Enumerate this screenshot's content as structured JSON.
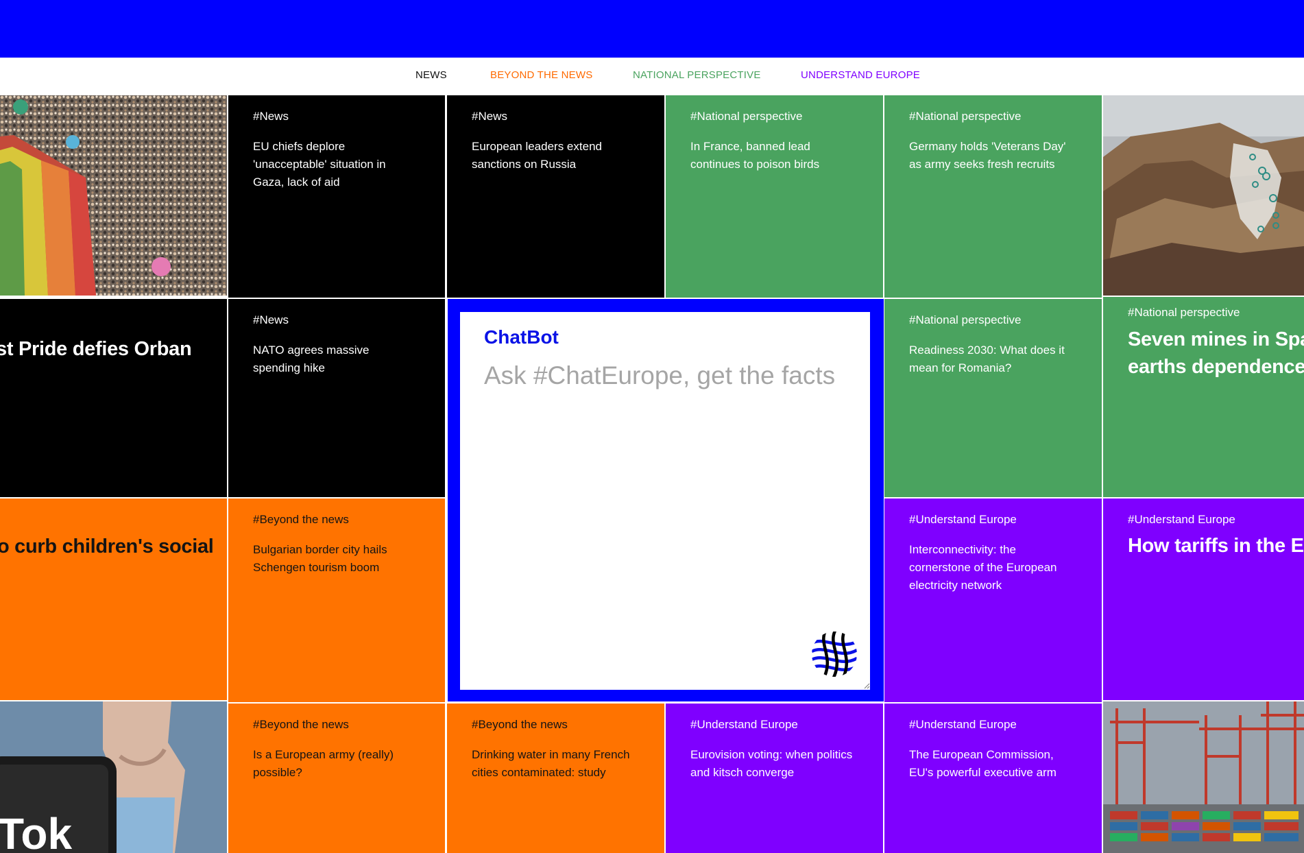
{
  "nav": {
    "items": [
      {
        "label": "NEWS",
        "color": "#111111"
      },
      {
        "label": "BEYOND THE NEWS",
        "color": "#ff6a00"
      },
      {
        "label": "NATIONAL PERSPECTIVE",
        "color": "#4aa35f"
      },
      {
        "label": "UNDERSTAND EUROPE",
        "color": "#7f00ff"
      }
    ]
  },
  "colors": {
    "brand_blue": "#0000ff",
    "news": "#000000",
    "national": "#4aa35f",
    "beyond": "#ff7300",
    "understand": "#7f00ff"
  },
  "tiles": {
    "t1": {
      "tag": "#News",
      "title": "EU chiefs deplore 'unacceptable' situation in Gaza, lack of aid"
    },
    "t2": {
      "tag": "#News",
      "title": "European leaders extend sanctions on Russia"
    },
    "t3": {
      "tag": "#National perspective",
      "title": "In France, banned lead continues to poison birds"
    },
    "t4": {
      "tag": "#National perspective",
      "title": "Germany holds 'Veterans Day' as army seeks fresh recruits"
    },
    "t5": {
      "tag": "#News",
      "title": "NATO agrees massive spending hike"
    },
    "t6": {
      "tag": "#National perspective",
      "title": "Readiness 2030: What does it mean for Romania?"
    },
    "t7": {
      "tag": "#Beyond the news",
      "title": "Bulgarian border city hails Schengen tourism boom"
    },
    "t8": {
      "tag": "#Understand Europe",
      "title": "Interconnectivity: the cornerstone of the European electricity network"
    },
    "t9": {
      "tag": "#Beyond the news",
      "title": "Is a European army (really) possible?"
    },
    "t10": {
      "tag": "#Beyond the news",
      "title": "Drinking water in many French cities contaminated: study"
    },
    "t11": {
      "tag": "#Understand Europe",
      "title": "Eurovision voting: when politics and kitsch converge"
    },
    "t12": {
      "tag": "#Understand Europe",
      "title": "The European Commission, EU's powerful executive arm"
    }
  },
  "feature_tiles": {
    "pride": {
      "title": "st Pride defies Orban"
    },
    "social": {
      "title": "o curb children's social"
    },
    "mines": {
      "tag": "#National perspective",
      "title_line1": "Seven mines in Spair",
      "title_line2": "earths dependence"
    },
    "tariffs": {
      "tag": "#Understand Europe",
      "title": "How tariffs in the EU"
    },
    "tiktok": {
      "logo_text": "Tok"
    }
  },
  "chatbot": {
    "title": "ChatBot",
    "placeholder": "Ask #ChatEurope, get the facts",
    "logo_icon": "chateurope-logo-icon"
  }
}
